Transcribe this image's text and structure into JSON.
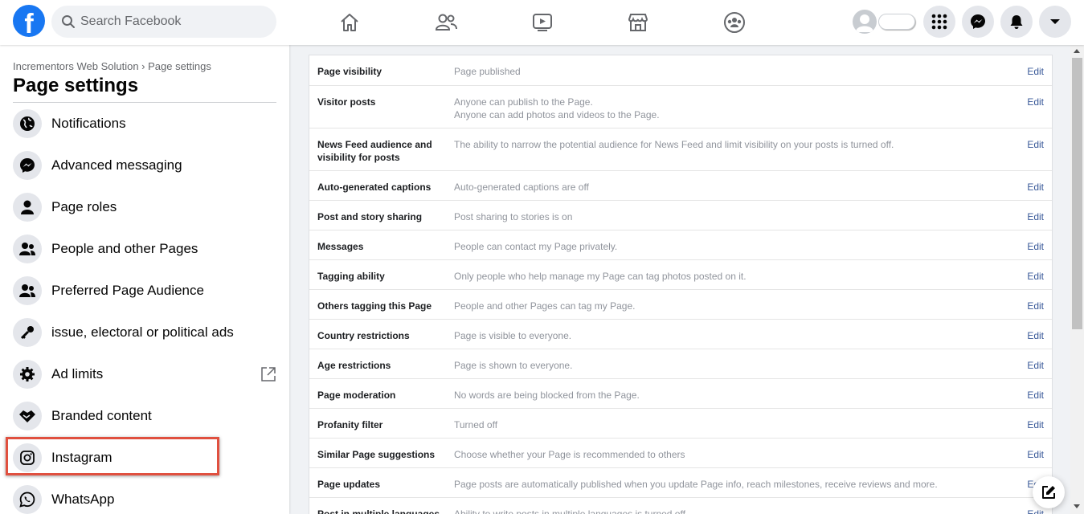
{
  "topbar": {
    "logo_letter": "f",
    "search_placeholder": "Search Facebook",
    "nav_icons": [
      "home-icon",
      "friends-icon",
      "watch-icon",
      "marketplace-icon",
      "groups-icon"
    ],
    "right_icons": [
      "menu-grid-icon",
      "messenger-icon",
      "notifications-icon",
      "account-dropdown-icon"
    ]
  },
  "sidebar": {
    "breadcrumb": "Incrementors Web Solution › Page settings",
    "title": "Page settings",
    "items": [
      {
        "label": "Notifications",
        "icon": "globe-icon"
      },
      {
        "label": "Advanced messaging",
        "icon": "messenger-icon"
      },
      {
        "label": "Page roles",
        "icon": "person-icon"
      },
      {
        "label": "People and other Pages",
        "icon": "people-icon"
      },
      {
        "label": "Preferred Page Audience",
        "icon": "people-icon"
      },
      {
        "label": "issue, electoral or political ads",
        "icon": "key-icon"
      },
      {
        "label": "Ad limits",
        "icon": "gear-icon"
      },
      {
        "label": "Branded content",
        "icon": "handshake-icon"
      },
      {
        "label": "Instagram",
        "icon": "instagram-icon"
      },
      {
        "label": "WhatsApp",
        "icon": "whatsapp-icon"
      }
    ]
  },
  "settings": {
    "edit_label": "Edit",
    "rows": [
      {
        "label": "Page visibility",
        "value": "Page published"
      },
      {
        "label": "Visitor posts",
        "value": "Anyone can publish to the Page.",
        "value2": "Anyone can add photos and videos to the Page."
      },
      {
        "label": "News Feed audience and visibility for posts",
        "value": "The ability to narrow the potential audience for News Feed and limit visibility on your posts is turned off."
      },
      {
        "label": "Auto-generated captions",
        "value": "Auto-generated captions are off"
      },
      {
        "label": "Post and story sharing",
        "value": "Post sharing to stories is on"
      },
      {
        "label": "Messages",
        "value": "People can contact my Page privately."
      },
      {
        "label": "Tagging ability",
        "value": "Only people who help manage my Page can tag photos posted on it."
      },
      {
        "label": "Others tagging this Page",
        "value": "People and other Pages can tag my Page."
      },
      {
        "label": "Country restrictions",
        "value": "Page is visible to everyone."
      },
      {
        "label": "Age restrictions",
        "value": "Page is shown to everyone."
      },
      {
        "label": "Page moderation",
        "value": "No words are being blocked from the Page."
      },
      {
        "label": "Profanity filter",
        "value": "Turned off"
      },
      {
        "label": "Similar Page suggestions",
        "value": "Choose whether your Page is recommended to others"
      },
      {
        "label": "Page updates",
        "value": "Page posts are automatically published when you update Page info, reach milestones, receive reviews and more."
      },
      {
        "label": "Post in multiple languages",
        "value": "Ability to write posts in multiple languages is turned off."
      }
    ]
  },
  "colors": {
    "brand": "#1877f2",
    "link": "#385898",
    "highlight": "#e0503f"
  }
}
